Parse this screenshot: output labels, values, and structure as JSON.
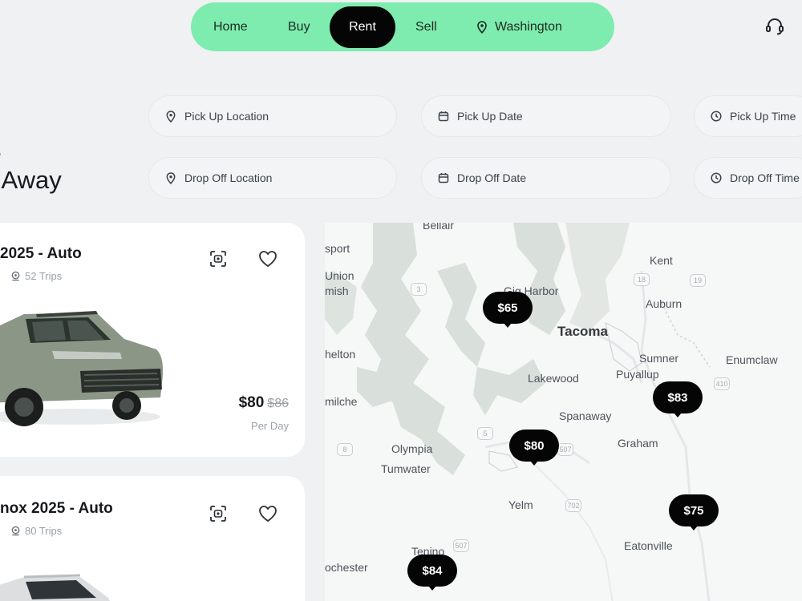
{
  "nav": {
    "items": [
      "Home",
      "Buy",
      "Rent",
      "Sell"
    ],
    "active": "Rent",
    "location": "Washington"
  },
  "header": {
    "support_icon": "headset-icon"
  },
  "headline": {
    "line1": "s",
    "line2": "t Away"
  },
  "search": {
    "pickup_location": "Pick Up Location",
    "pickup_date": "Pick Up Date",
    "pickup_time": "Pick Up Time",
    "dropoff_location": "Drop Off Location",
    "dropoff_date": "Drop Off Date",
    "dropoff_time": "Drop Off Time"
  },
  "cars": [
    {
      "title": "2025 - Auto",
      "trips": "52 Trips",
      "price": "$80",
      "old_price": "$86",
      "per": "Per Day",
      "color": "#7f8b7a"
    },
    {
      "title": "nox 2025 - Auto",
      "trips": "80 Trips",
      "color": "#d7d9db"
    }
  ],
  "map": {
    "places": [
      "Bellair",
      "sport",
      "Union",
      "mish",
      "Gig Harbor",
      "Kent",
      "Auburn",
      "Tacoma",
      "Sumner",
      "Enumclaw",
      "helton",
      "Lakewood",
      "Puyallup",
      "milche",
      "Spanaway",
      "Olympia",
      "Tumwater",
      "Graham",
      "Yelm",
      "Eatonville",
      "ochester",
      "Tenino"
    ],
    "pins": [
      "$65",
      "$83",
      "$80",
      "$75",
      "$84"
    ],
    "colors": {
      "water": "#d9dfdb",
      "land": "#f6f7f7",
      "pin": "#050505"
    }
  }
}
